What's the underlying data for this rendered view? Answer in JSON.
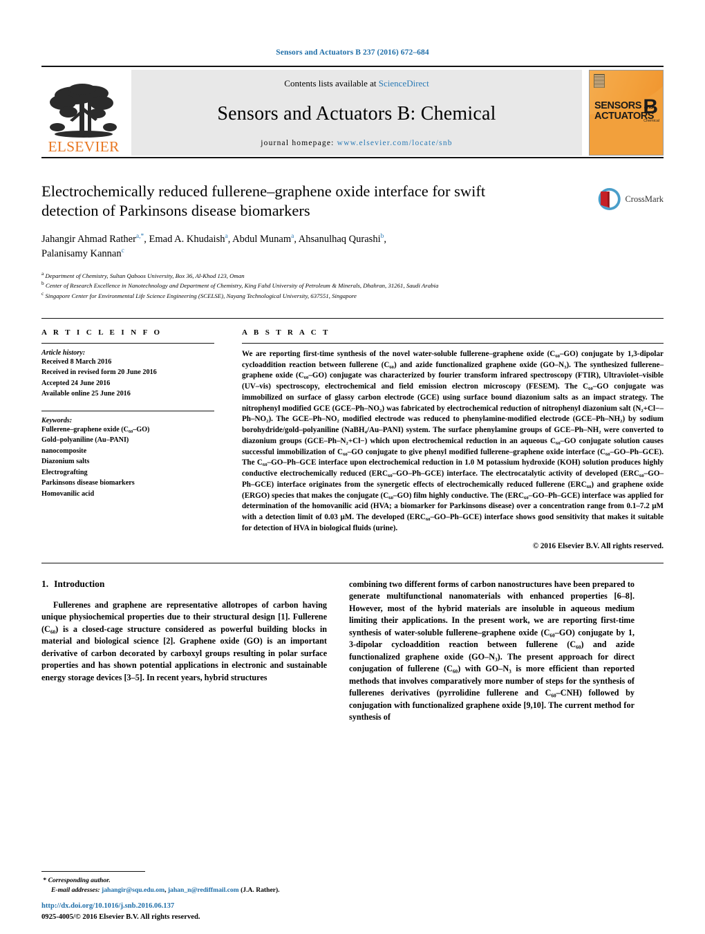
{
  "running_head": "Sensors and Actuators B 237 (2016) 672–684",
  "masthead": {
    "contents_prefix": "Contents lists available at ",
    "sciencedirect": "ScienceDirect",
    "journal_name": "Sensors and Actuators B: Chemical",
    "homepage_label": "journal homepage: ",
    "homepage_url": "www.elsevier.com/locate/snb",
    "publisher": "ELSEVIER",
    "cover": {
      "line1": "SENSORS",
      "line2": "ACTUATORS",
      "and": "and",
      "letter": "B",
      "sub": "Chemical"
    }
  },
  "crossmark": {
    "label": "CrossMark"
  },
  "title": "Electrochemically reduced fullerene–graphene oxide interface for swift detection of Parkinsons disease biomarkers",
  "authors": [
    {
      "name": "Jahangir Ahmad Rather",
      "marks": "a,*"
    },
    {
      "name": "Emad A. Khudaish",
      "marks": "a"
    },
    {
      "name": "Abdul Munam",
      "marks": "a"
    },
    {
      "name": "Ahsanulhaq Qurashi",
      "marks": "b"
    },
    {
      "name": "Palanisamy Kannan",
      "marks": "c"
    }
  ],
  "affiliations": [
    {
      "mark": "a",
      "text": "Department of Chemistry, Sultan Qaboos University, Box 36, Al-Khod 123, Oman"
    },
    {
      "mark": "b",
      "text": "Center of Research Excellence in Nanotechnology and Department of Chemistry, King Fahd University of Petroleum & Minerals, Dhahran, 31261, Saudi Arabia"
    },
    {
      "mark": "c",
      "text": "Singapore Center for Environmental Life Science Engineering (SCELSE), Nayang Technological University, 637551, Singapore"
    }
  ],
  "article_info": {
    "heading": "A R T I C L E    I N F O",
    "history_label": "Article history:",
    "history": [
      "Received 8 March 2016",
      "Received in revised form 20 June 2016",
      "Accepted 24 June 2016",
      "Available online 25 June 2016"
    ],
    "keywords_label": "Keywords:",
    "keywords": [
      "Fullerene–graphene oxide (C60–GO)",
      "Gold–polyaniline (Au–PANI)",
      "nanocomposite",
      "Diazonium salts",
      "Electrografting",
      "Parkinsons disease biomarkers",
      "Homovanilic acid"
    ]
  },
  "abstract": {
    "heading": "A B S T R A C T",
    "text": "We are reporting first-time synthesis of the novel water-soluble fullerene–graphene oxide (C60–GO) conjugate by 1,3-dipolar cycloaddition reaction between fullerene (C60) and azide functionalized graphene oxide (GO–N3). The synthesized fullerene–graphene oxide (C60–GO) conjugate was characterized by fourier transform infrared spectroscopy (FTIR), Ultraviolet–visible (UV–vis) spectroscopy, electrochemical and field emission electron microscopy (FESEM). The C60–GO conjugate was immobilized on surface of glassy carbon electrode (GCE) using surface bound diazonium salts as an impact strategy. The nitrophenyl modified GCE (GCE–Ph–NO2) was fabricated by electrochemical reduction of nitrophenyl diazonium salt (N2+Cl−–Ph–NO2). The GCE–Ph–NO2 modified electrode was reduced to phenylamine-modified electrode (GCE–Ph–NH2) by sodium borohydride/gold–polyaniline (NaBH4/Au–PANI) system. The surface phenylamine groups of GCE–Ph–NH2 were converted to diazonium groups (GCE–Ph–N2+Cl−) which upon electrochemical reduction in an aqueous C60–GO conjugate solution causes successful immobilization of C60–GO conjugate to give phenyl modified fullerene–graphene oxide interface (C60–GO–Ph–GCE). The C60–GO–Ph–GCE interface upon electrochemical reduction in 1.0 M potassium hydroxide (KOH) solution produces highly conductive electrochemically reduced (ERC60–GO–Ph–GCE) interface. The electrocatalytic activity of developed (ERC60–GO–Ph–GCE) interface originates from the synergetic effects of electrochemically reduced fullerene (ERC60) and graphene oxide (ERGO) species that makes the conjugate (C60–GO) film highly conductive. The (ERC60–GO–Ph–GCE) interface was applied for determination of the homovanilic acid (HVA; a biomarker for Parkinsons disease) over a concentration range from 0.1–7.2 μM with a detection limit of 0.03 μM. The developed (ERC60–GO–Ph–GCE) interface shows good sensitivity that makes it suitable for detection of HVA in biological fluids (urine).",
    "copyright": "© 2016 Elsevier B.V. All rights reserved."
  },
  "introduction": {
    "number": "1.",
    "heading": "Introduction",
    "left_paragraph": "Fullerenes and graphene are representative allotropes of carbon having unique physiochemical properties due to their structural design [1]. Fullerene (C60) is a closed-cage structure considered as powerful building blocks in material and biological science [2]. Graphene oxide (GO) is an important derivative of carbon decorated by carboxyl groups resulting in polar surface properties and has shown potential applications in electronic and sustainable energy storage devices [3–5]. In recent years, hybrid structures",
    "right_paragraph": "combining two different forms of carbon nanostructures have been prepared to generate multifunctional nanomaterials with enhanced properties [6–8]. However, most of the hybrid materials are insoluble in aqueous medium limiting their applications. In the present work, we are reporting first-time synthesis of water-soluble fullerene–graphene oxide (C60–GO) conjugate by 1, 3-dipolar cycloaddition reaction between fullerene (C60) and azide functionalized graphene oxide (GO–N3). The present approach for direct conjugation of fullerene (C60) with GO–N3 is more efficient than reported methods that involves comparatively more number of steps for the synthesis of fullerenes derivatives (pyrrolidine fullerene and C60–CNH) followed by conjugation with functionalized graphene oxide [9,10]. The current method for synthesis of"
  },
  "footer": {
    "corresponding_marker": "*",
    "corresponding_label": "Corresponding author.",
    "email_label": "E-mail addresses:",
    "email1": "jahangir@squ.edu.om",
    "email2": "jahan_n@rediffmail.com",
    "email_suffix": "(J.A. Rather).",
    "doi": "http://dx.doi.org/10.1016/j.snb.2016.06.137",
    "issn_line": "0925-4005/© 2016 Elsevier B.V. All rights reserved."
  },
  "colors": {
    "link": "#1f6ea8",
    "elsevier_orange": "#E87722",
    "mast_bg": "#e8e8e8"
  }
}
